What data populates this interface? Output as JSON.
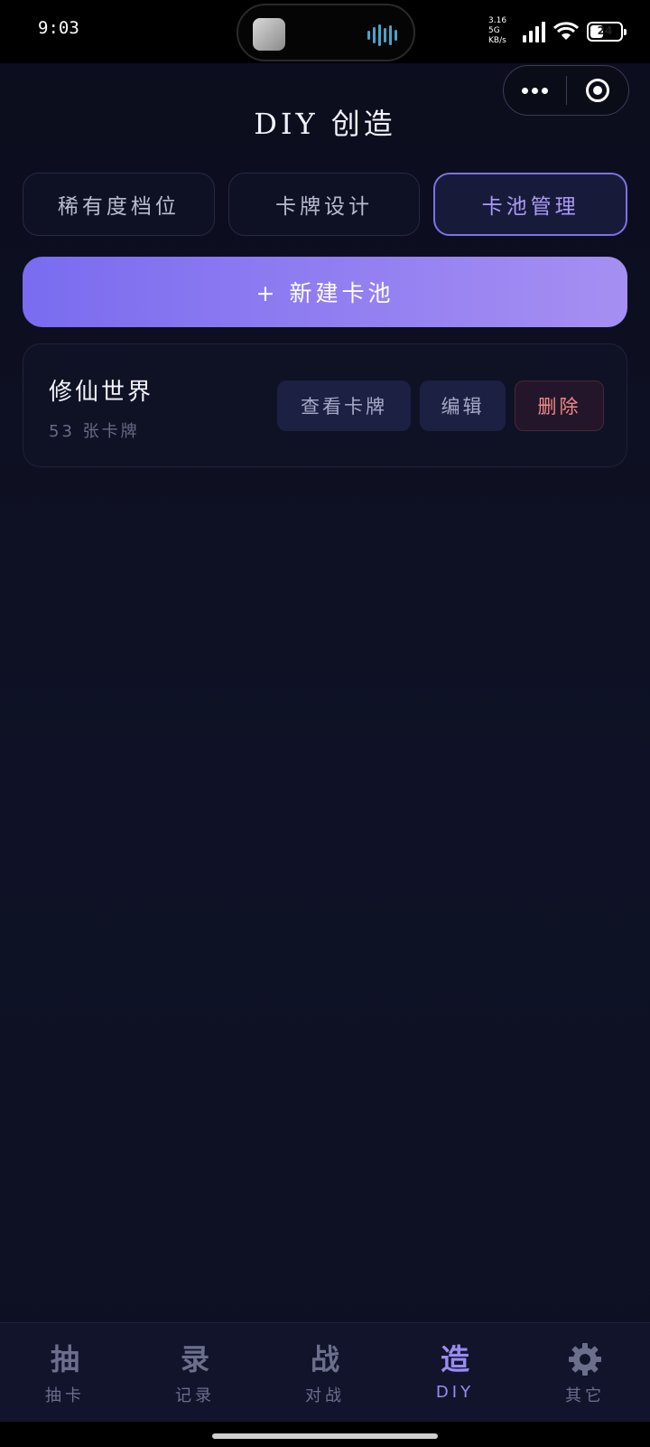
{
  "status_bar": {
    "time": "9:03",
    "net_speed": "3.16",
    "net_unit": "KB/s",
    "net_type": "5G",
    "battery": "24"
  },
  "header": {
    "title": "DIY 创造"
  },
  "tabs": [
    {
      "label": "稀有度档位",
      "active": false
    },
    {
      "label": "卡牌设计",
      "active": false
    },
    {
      "label": "卡池管理",
      "active": true
    }
  ],
  "new_pool_button": "+ 新建卡池",
  "pools": [
    {
      "name": "修仙世界",
      "count": "53 张卡牌",
      "actions": {
        "view": "查看卡牌",
        "edit": "编辑",
        "delete": "删除"
      }
    }
  ],
  "bottom_nav": [
    {
      "icon": "抽",
      "label": "抽卡",
      "active": false
    },
    {
      "icon": "录",
      "label": "记录",
      "active": false
    },
    {
      "icon": "战",
      "label": "对战",
      "active": false
    },
    {
      "icon": "造",
      "label": "DIY",
      "active": true
    },
    {
      "icon": "gear-icon",
      "label": "其它",
      "active": false
    }
  ],
  "colors": {
    "accent": "#8b7cf0",
    "danger": "#f08a8a",
    "background": "#0d1022"
  }
}
